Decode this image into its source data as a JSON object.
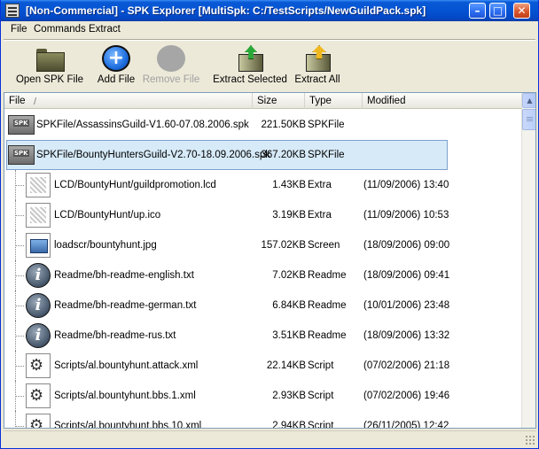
{
  "window": {
    "title": "[Non-Commercial] - SPK Explorer [MultiSpk: C:/TestScripts/NewGuildPack.spk]",
    "buttons": {
      "minimize": "–",
      "maximize": "□",
      "close": "✕"
    }
  },
  "menu": {
    "file": "File",
    "commands": "Commands",
    "extract": "Extract"
  },
  "toolbar": {
    "open_spk": "Open SPK File",
    "add_file": "Add File",
    "remove_file": "Remove File",
    "extract_selected": "Extract Selected",
    "extract_all": "Extract All"
  },
  "columns": {
    "file": "File",
    "sort_marker": "/",
    "size": "Size",
    "type": "Type",
    "modified": "Modified"
  },
  "rows": [
    {
      "icon": "spk-package-icon",
      "name": "SPKFile/AssassinsGuild-V1.60-07.08.2006.spk",
      "size": "221.50KB",
      "type": "SPKFile",
      "modified": "",
      "level": 0,
      "selected": false
    },
    {
      "icon": "spk-package-icon",
      "name": "SPKFile/BountyHuntersGuild-V2.70-18.09.2006.spk",
      "size": "367.20KB",
      "type": "SPKFile",
      "modified": "",
      "level": 0,
      "selected": true
    },
    {
      "icon": "document-icon",
      "name": "LCD/BountyHunt/guildpromotion.lcd",
      "size": "1.43KB",
      "type": "Extra",
      "modified": "(11/09/2006) 13:40",
      "level": 1,
      "selected": false
    },
    {
      "icon": "document-icon",
      "name": "LCD/BountyHunt/up.ico",
      "size": "3.19KB",
      "type": "Extra",
      "modified": "(11/09/2006) 10:53",
      "level": 1,
      "selected": false
    },
    {
      "icon": "image-icon",
      "name": "loadscr/bountyhunt.jpg",
      "size": "157.02KB",
      "type": "Screen",
      "modified": "(18/09/2006) 09:00",
      "level": 1,
      "selected": false
    },
    {
      "icon": "info-icon",
      "name": "Readme/bh-readme-english.txt",
      "size": "7.02KB",
      "type": "Readme",
      "modified": "(18/09/2006) 09:41",
      "level": 1,
      "selected": false
    },
    {
      "icon": "info-icon",
      "name": "Readme/bh-readme-german.txt",
      "size": "6.84KB",
      "type": "Readme",
      "modified": "(10/01/2006) 23:48",
      "level": 1,
      "selected": false
    },
    {
      "icon": "info-icon",
      "name": "Readme/bh-readme-rus.txt",
      "size": "3.51KB",
      "type": "Readme",
      "modified": "(18/09/2006) 13:32",
      "level": 1,
      "selected": false
    },
    {
      "icon": "script-icon",
      "name": "Scripts/al.bountyhunt.attack.xml",
      "size": "22.14KB",
      "type": "Script",
      "modified": "(07/02/2006) 21:18",
      "level": 1,
      "selected": false
    },
    {
      "icon": "script-icon",
      "name": "Scripts/al.bountyhunt.bbs.1.xml",
      "size": "2.93KB",
      "type": "Script",
      "modified": "(07/02/2006) 19:46",
      "level": 1,
      "selected": false
    },
    {
      "icon": "script-icon",
      "name": "Scripts/al.bountyhunt.bbs.10.xml",
      "size": "2.94KB",
      "type": "Script",
      "modified": "(26/11/2005) 12:42",
      "level": 1,
      "selected": false
    }
  ]
}
